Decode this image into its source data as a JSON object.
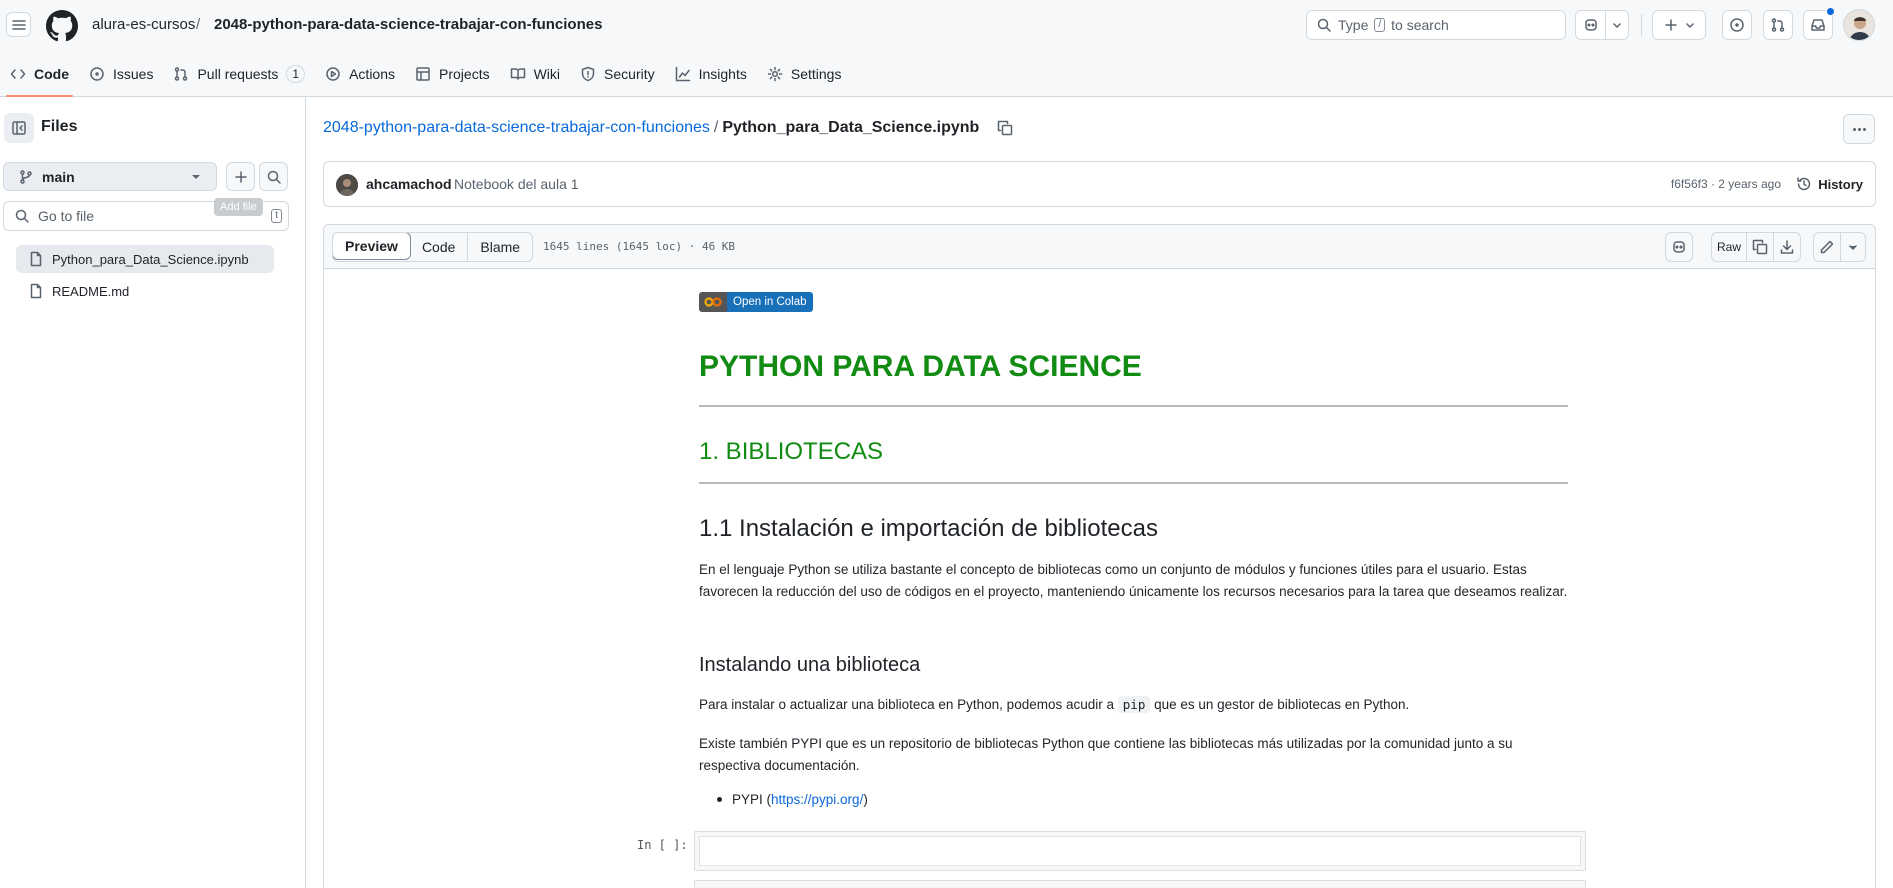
{
  "header": {
    "owner": "alura-es-cursos",
    "separator": "/",
    "repo": "2048-python-para-data-science-trabajar-con-funciones",
    "search_placeholder_pre": "Type",
    "search_key": "/",
    "search_placeholder_post": "to search"
  },
  "nav": {
    "tabs": [
      {
        "label": "Code",
        "icon": "code-icon"
      },
      {
        "label": "Issues",
        "icon": "issue-icon"
      },
      {
        "label": "Pull requests",
        "icon": "pull-request-icon",
        "count": "1"
      },
      {
        "label": "Actions",
        "icon": "play-icon"
      },
      {
        "label": "Projects",
        "icon": "table-icon"
      },
      {
        "label": "Wiki",
        "icon": "book-icon"
      },
      {
        "label": "Security",
        "icon": "shield-icon"
      },
      {
        "label": "Insights",
        "icon": "graph-icon"
      },
      {
        "label": "Settings",
        "icon": "gear-icon"
      }
    ]
  },
  "sidebar": {
    "title": "Files",
    "branch": "main",
    "goto_placeholder": "Go to file",
    "goto_key": "t",
    "tooltip": "Add file",
    "files": [
      {
        "name": "Python_para_Data_Science.ipynb",
        "active": true
      },
      {
        "name": "README.md",
        "active": false
      }
    ]
  },
  "path": {
    "repo_link": "2048-python-para-data-science-trabajar-con-funciones",
    "separator": "/",
    "file": "Python_para_Data_Science.ipynb"
  },
  "commit": {
    "author": "ahcamachod",
    "message": "Notebook del aula 1",
    "meta": "f6f56f3 · 2 years ago",
    "history_label": "History"
  },
  "file_header": {
    "tabs": [
      "Preview",
      "Code",
      "Blame"
    ],
    "info": "1645 lines (1645 loc) · 46 KB",
    "raw_label": "Raw"
  },
  "notebook": {
    "colab_badge": "Open in Colab",
    "h1": "PYTHON PARA DATA SCIENCE",
    "h2": "1. BIBLIOTECAS",
    "h3": "1.1 Instalación e importación de bibliotecas",
    "p1": "En el lenguaje Python se utiliza bastante el concepto de bibliotecas como un conjunto de módulos y funciones útiles para el usuario. Estas favorecen la reducción del uso de códigos en el proyecto, manteniendo únicamente los recursos necesarios para la tarea que deseamos realizar.",
    "h4": "Instalando una biblioteca",
    "p2_pre": "Para instalar o actualizar una biblioteca en Python, podemos acudir a",
    "p2_code": "pip",
    "p2_post": "que es un gestor de bibliotecas en Python.",
    "p3": "Existe también PYPI que es un repositorio de bibliotecas Python que contiene las bibliotecas más utilizadas por la comunidad junto a su respectiva documentación.",
    "bullet_label": "PYPI (",
    "bullet_link": "https://pypi.org/",
    "bullet_close": ")",
    "prompt": "In [ ]:"
  },
  "colors": {
    "heading_green": "#118b11",
    "link_blue": "#0969da",
    "tab_underline": "#fd8c73",
    "colab_blue": "#1770b8"
  }
}
